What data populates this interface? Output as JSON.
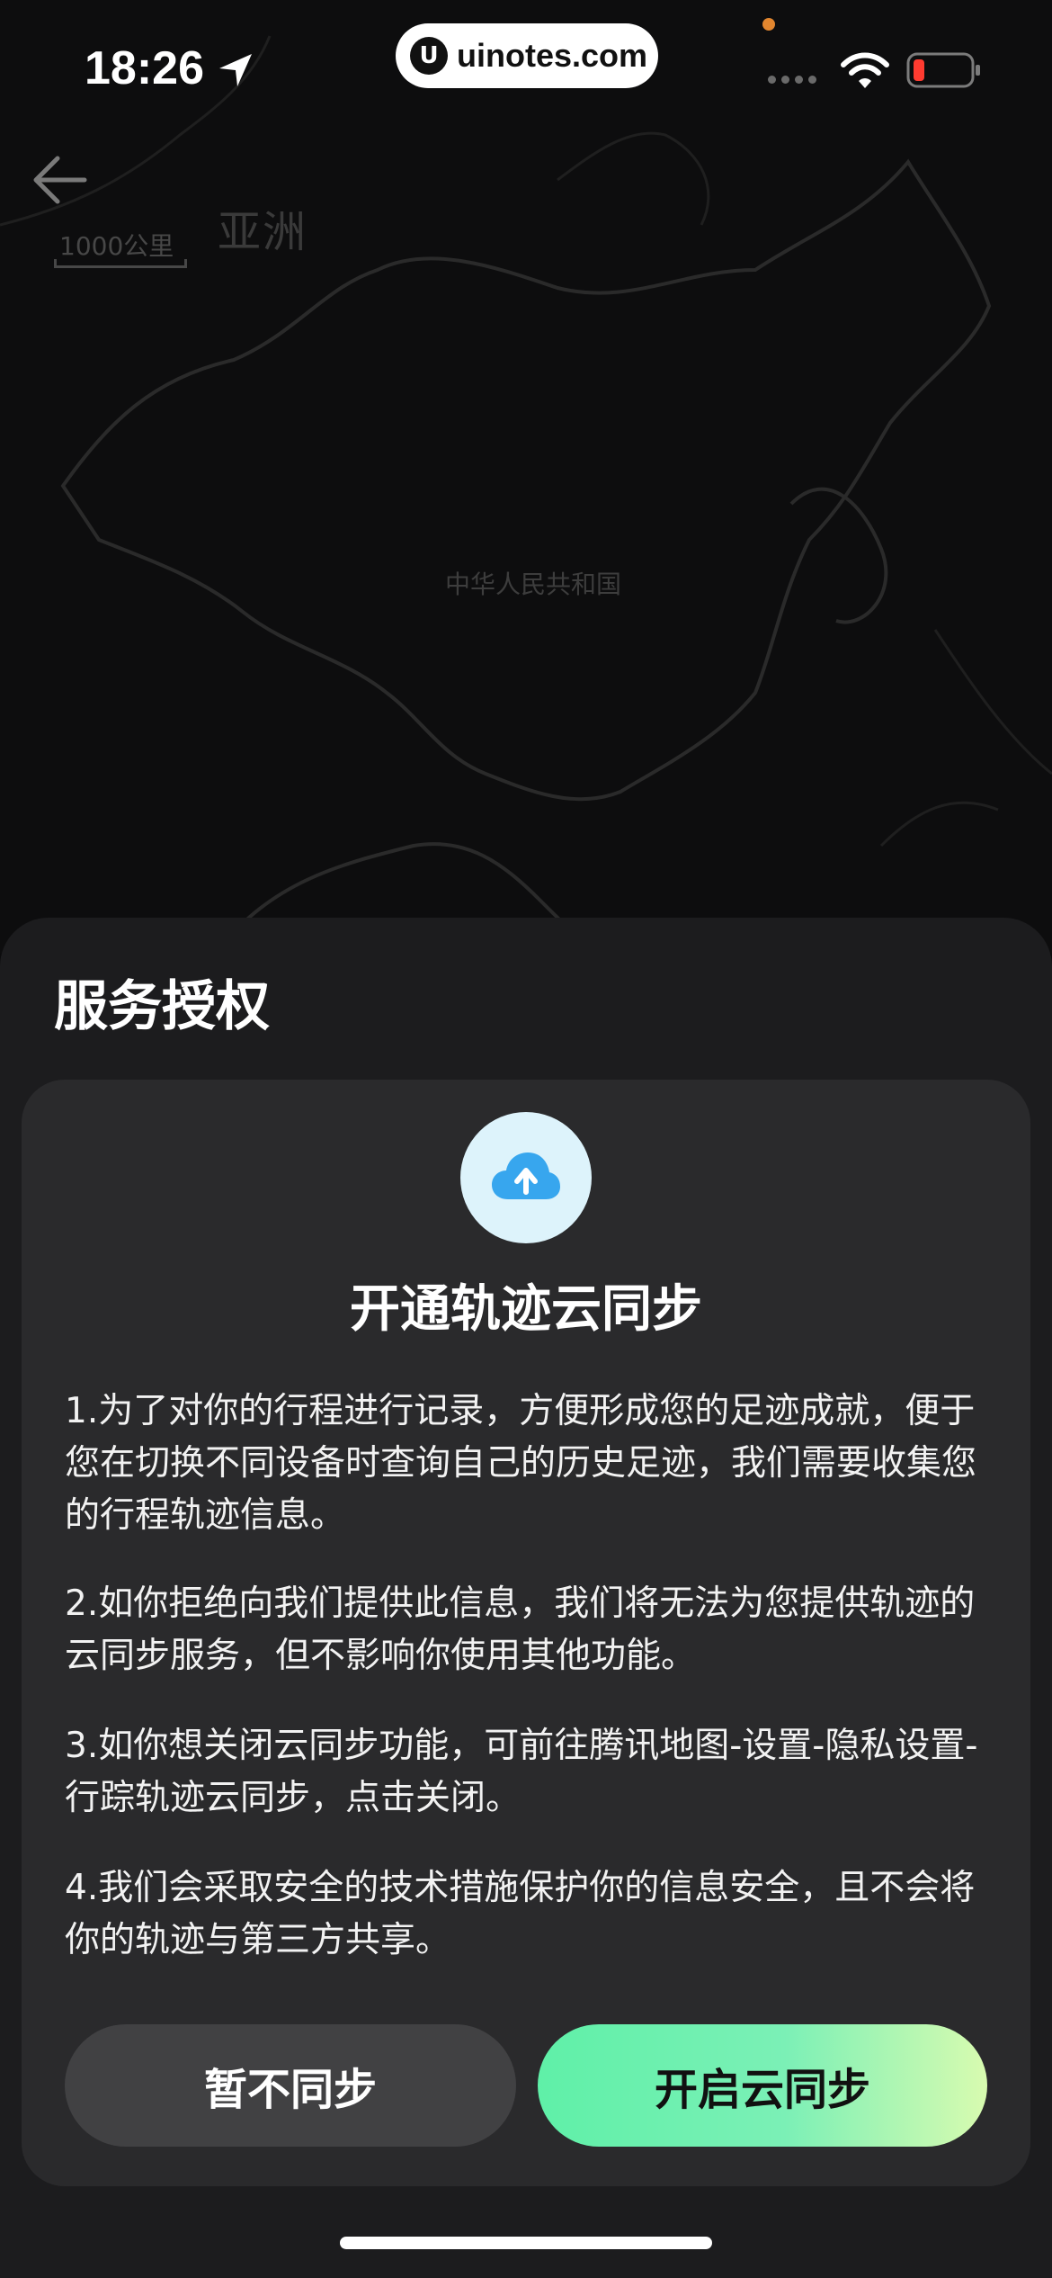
{
  "status_bar": {
    "time": "18:26",
    "url": "uinotes.com",
    "url_logo": "U"
  },
  "map": {
    "continent_label": "亚洲",
    "country_label": "中华人民共和国",
    "scale_label": "1000公里"
  },
  "sheet": {
    "title": "服务授权",
    "card_title": "开通轨迹云同步",
    "paragraphs": [
      "1.为了对你的行程进行记录，方便形成您的足迹成就，便于您在切换不同设备时查询自己的历史足迹，我们需要收集您的行程轨迹信息。",
      "2.如你拒绝向我们提供此信息，我们将无法为您提供轨迹的云同步服务，但不影响你使用其他功能。",
      "3.如你想关闭云同步功能，可前往腾讯地图-设置-隐私设置-行踪轨迹云同步，点击关闭。",
      "4.我们会采取安全的技术措施保护你的信息安全，且不会将你的轨迹与第三方共享。"
    ],
    "decline_label": "暂不同步",
    "accept_label": "开启云同步"
  },
  "colors": {
    "accent_gradient_start": "#5ff0a8",
    "accent_gradient_end": "#d8fbb0",
    "sheet_bg": "#1c1c1e",
    "card_bg": "#2a2a2c"
  },
  "icons": {
    "back": "arrow-left-icon",
    "cloud": "cloud-upload-icon",
    "location": "location-arrow-icon",
    "wifi": "wifi-icon",
    "battery": "battery-low-icon"
  }
}
